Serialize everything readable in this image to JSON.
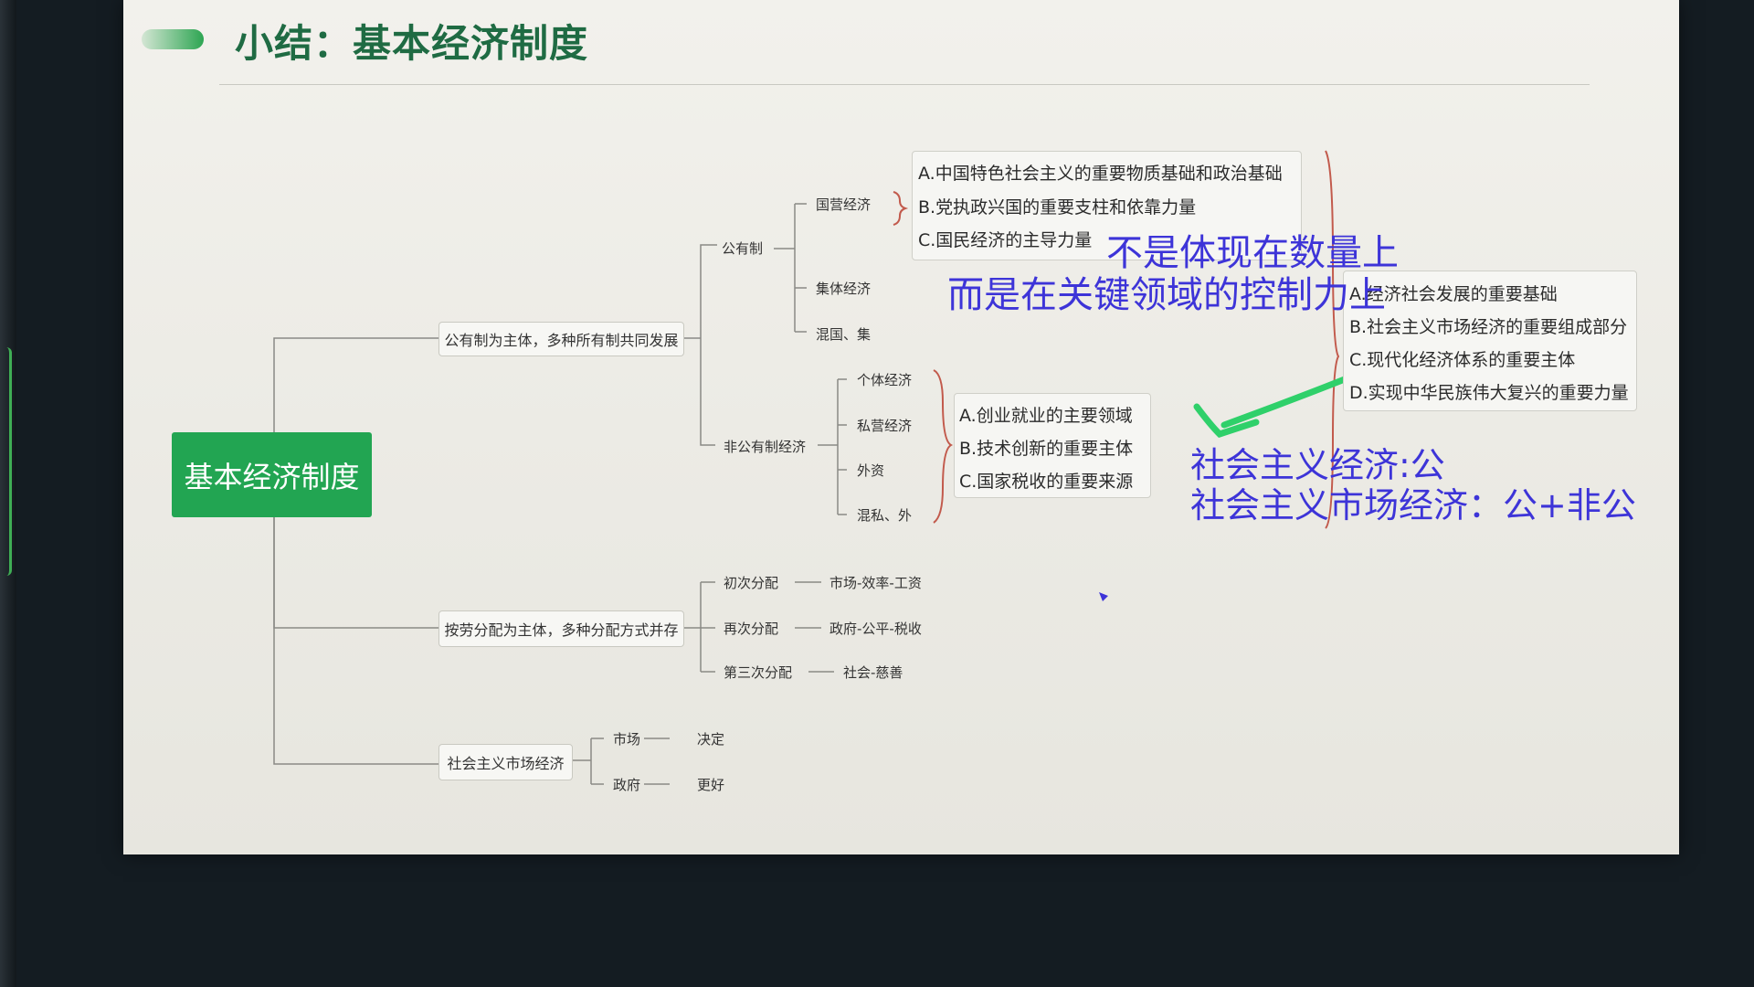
{
  "slide": {
    "title": "小结：基本经济制度",
    "root": "基本经济制度"
  },
  "branches": {
    "public_main": "公有制为主体，多种所有制共同发展",
    "distribution": "按劳分配为主体，多种分配方式并存",
    "market": "社会主义市场经济"
  },
  "public": {
    "label": "公有制",
    "children": [
      "国营经济",
      "集体经济",
      "混国、集"
    ],
    "state_roles": [
      "A.中国特色社会主义的重要物质基础和政治基础",
      "B.党执政兴国的重要支柱和依靠力量",
      "C.国民经济的主导力量"
    ]
  },
  "nonpublic": {
    "label": "非公有制经济",
    "children": [
      "个体经济",
      "私营经济",
      "外资",
      "混私、外"
    ],
    "roles": [
      "A.创业就业的主要领域",
      "B.技术创新的重要主体",
      "C.国家税收的重要来源"
    ]
  },
  "both_roles": [
    "A.经济社会发展的重要基础",
    "B.社会主义市场经济的重要组成部分",
    "C.现代化经济体系的重要主体",
    "D.实现中华民族伟大复兴的重要力量"
  ],
  "distribution_rows": [
    {
      "label": "初次分配",
      "value": "市场-效率-工资"
    },
    {
      "label": "再次分配",
      "value": "政府-公平-税收"
    },
    {
      "label": "第三次分配",
      "value": "社会-慈善"
    }
  ],
  "market_rows": [
    {
      "label": "市场",
      "value": "决定"
    },
    {
      "label": "政府",
      "value": "更好"
    }
  ],
  "handwriting": {
    "line1": "不是体现在数量上",
    "line2": "而是在关键领域的控制力上",
    "line3": "社会主义经济:公",
    "line4": "社会主义市场经济：公+非公"
  },
  "colors": {
    "accent": "#22a552",
    "ink": "#3d34d8",
    "arrow": "#2fd06a"
  }
}
